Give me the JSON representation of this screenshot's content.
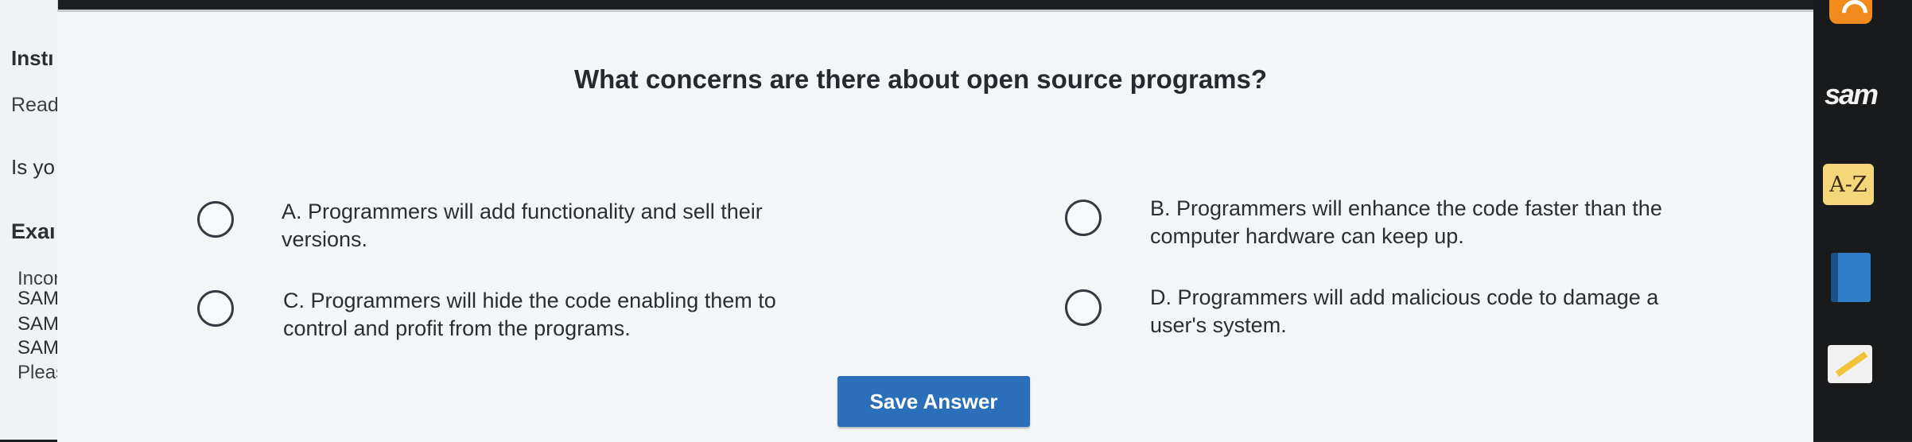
{
  "sidebar": {
    "instructions_fragment": "Instı",
    "read_fragment": "Read",
    "is_you_fragment": "Is yo",
    "exam_fragment": "Exaı",
    "incorrect_fragment": "Incor",
    "sam_line1": "SAM",
    "sam_line2": "SAM",
    "sam_line3": "SAM",
    "please_fragment": "Pleas"
  },
  "question": {
    "text": "What concerns are there about open source programs?",
    "options": [
      {
        "line1": "A. Programmers will add functionality and sell their",
        "line2": "versions."
      },
      {
        "line1": "B. Programmers will enhance the code faster than the",
        "line2": "computer hardware can keep up."
      },
      {
        "line1": "C. Programmers will hide the code enabling them to",
        "line2": "control and profit from the programs."
      },
      {
        "line1": "D. Programmers will add malicious code to damage a",
        "line2": "user's system."
      }
    ],
    "save_label": "Save Answer"
  },
  "toolbar": {
    "logo": "sam",
    "az_label": "A-Z",
    "icons": [
      "rss-icon",
      "sam-logo",
      "a-z-glossary-icon",
      "book-icon",
      "notes-icon"
    ]
  },
  "colors": {
    "accent": "#2b6fba",
    "panel": "#f4f5f7",
    "dark_bar": "#181a1c"
  }
}
